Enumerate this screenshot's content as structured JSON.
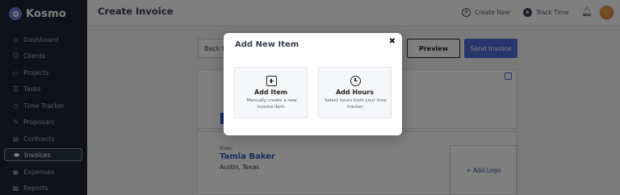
{
  "app": {
    "name": "Kosmo"
  },
  "sidebar": {
    "items": [
      {
        "label": "Dashboard",
        "icon": "home-icon"
      },
      {
        "label": "Clients",
        "icon": "clients-icon"
      },
      {
        "label": "Projects",
        "icon": "folder-icon"
      },
      {
        "label": "Tasks",
        "icon": "tasks-icon"
      },
      {
        "label": "Time Tracker",
        "icon": "clock-icon"
      },
      {
        "label": "Proposals",
        "icon": "proposals-icon"
      },
      {
        "label": "Contracts",
        "icon": "contracts-icon"
      },
      {
        "label": "Invoices",
        "icon": "invoices-icon",
        "active": true
      },
      {
        "label": "Expenses",
        "icon": "expenses-icon"
      },
      {
        "label": "Reports",
        "icon": "reports-icon"
      }
    ]
  },
  "header": {
    "title": "Create Invoice",
    "create_new": "Create New",
    "track_time": "Track Time"
  },
  "toolbar": {
    "back_label": "Back t",
    "preview_label": "Preview",
    "send_label": "Send Invoice"
  },
  "invoice": {
    "from_label": "From:",
    "from_name": "Tamia Baker",
    "from_location": "Austin, Texas",
    "add_logo_label": "+ Add Logo"
  },
  "modal": {
    "title": "Add New Item",
    "close_glyph": "✖",
    "options": [
      {
        "title": "Add Item",
        "description": "Manually create a new invoice item.",
        "icon": "plus-square-icon"
      },
      {
        "title": "Add Hours",
        "description": "Select hours from your time tracker.",
        "icon": "clock-icon"
      }
    ]
  },
  "colors": {
    "sidebar_bg": "#1f2537",
    "accent": "#4f6fd8",
    "name_link": "#2a5db8"
  }
}
